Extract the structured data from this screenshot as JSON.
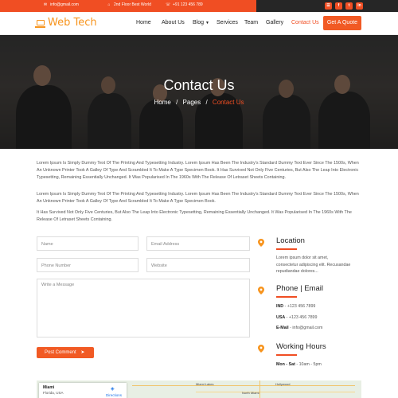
{
  "topbar": {
    "email": "info@gmail.com",
    "address": "2nd Floor Best World",
    "phone": "+91 123 456 789",
    "social": [
      {
        "icon": "rss-icon",
        "glyph": "☰"
      },
      {
        "icon": "facebook-icon",
        "glyph": "f"
      },
      {
        "icon": "twitter-icon",
        "glyph": "t"
      },
      {
        "icon": "linkedin-icon",
        "glyph": "in"
      }
    ]
  },
  "brand": {
    "name": "Web Tech",
    "icon": "laptop-icon",
    "color": "#f7941d"
  },
  "nav": {
    "items": [
      "Home",
      "About Us",
      "Blog",
      "Services",
      "Team",
      "Gallery",
      "Contact Us"
    ],
    "active": "Contact Us",
    "cta": "Get A Quote"
  },
  "hero": {
    "title": "Contact Us",
    "breadcrumb": [
      "Home",
      "Pages",
      "Contact Us"
    ],
    "separator": "/"
  },
  "intro": {
    "paragraphs": [
      "Lorem Ipsum Is Simply Dummy Text Of The Printing And Typesetting Industry. Lorem Ipsum Has Been The Industry's Standard Dummy Text Ever Since The 1500s, When An Unknown Printer Took A Galley Of Type And Scrambled It To Make A Type Specimen Book. It Has Survived Not Only Five Centuries, But Also The Leap Into Electronic Typesetting, Remaining Essentially Unchanged. It Was Popularised In The 1960s With The Release Of Letraset Sheets Containing.",
      "Lorem Ipsum Is Simply Dummy Text Of The Printing And Typesetting Industry. Lorem Ipsum Has Been The Industry's Standard Dummy Text Ever Since The 1500s, When An Unknown Printer Took A Galley Of Type And Scrambled It To Make A Type Specimen Book.",
      "It Has Survived Not Only Five Centuries, But Also The Leap Into Electronic Typesetting, Remaining Essentially Unchanged. It Was Popularised In The 1960s With The Release Of Letraset Sheets Containing."
    ]
  },
  "form": {
    "name_placeholder": "Name",
    "email_placeholder": "Email Address",
    "phone_placeholder": "Phone Number",
    "website_placeholder": "Website",
    "message_placeholder": "Write a Message",
    "submit_label": "Post Comment"
  },
  "info": {
    "location": {
      "title": "Location",
      "lines": [
        "Lorem ipsum dolor sit amet,",
        "consectetur adipiscing elit. Recusandae",
        "repudiandae dolores..."
      ]
    },
    "phone_email": {
      "title": "Phone | Email",
      "india_label": "IND",
      "india_value": "- +123 456 7899",
      "usa_label": "USA",
      "usa_value": "- +123 456 7899",
      "email_label": "E-Mail",
      "email_value": "- info@gmail.com"
    },
    "hours": {
      "title": "Working Hours",
      "days": "Mon - Sat",
      "time": "- 10am - 5pm"
    }
  },
  "map": {
    "city": "Miami",
    "state": "Florida, USA",
    "directions": "Directions",
    "labels": [
      "Miami Lakes",
      "North Miami",
      "Hollywood"
    ]
  },
  "colors": {
    "accent": "#f04e23",
    "orange": "#f15a24",
    "dark": "#262626"
  }
}
